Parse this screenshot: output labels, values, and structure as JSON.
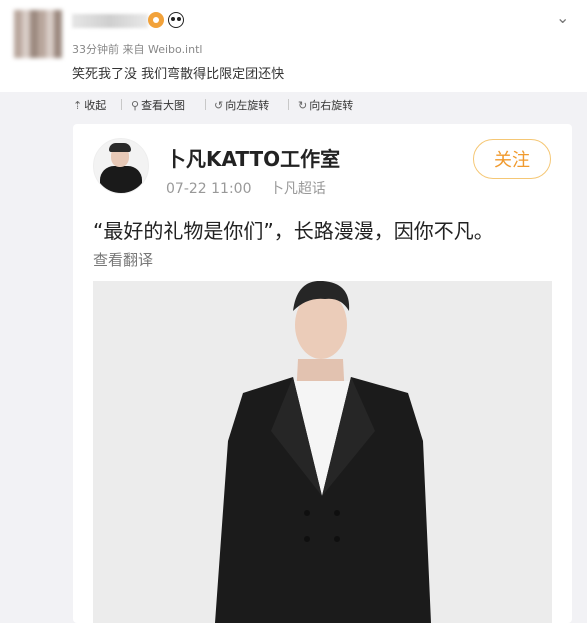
{
  "post": {
    "meta": "33分钟前 来自 Weibo.intl",
    "text": "笑死我了没 我们弯散得比限定团还快",
    "chevron": "⌄"
  },
  "toolbar": {
    "collapse": "收起",
    "view_large": "查看大图",
    "rotate_left": "向左旋转",
    "rotate_right": "向右旋转"
  },
  "repost": {
    "author": "卜凡KATTO工作室",
    "time": "07-22 11:00",
    "source": "卜凡超话",
    "follow_label": "关注",
    "text": "“最好的礼物是你们”，长路漫漫，因你不凡。",
    "translate_label": "查看翻译"
  }
}
